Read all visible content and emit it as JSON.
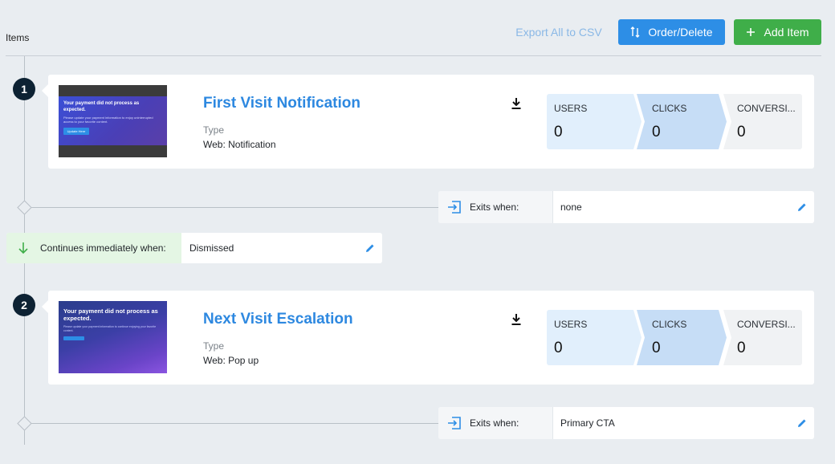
{
  "header": {
    "title": "Items",
    "export_label": "Export All to CSV",
    "order_label": "Order/Delete",
    "add_label": "Add Item"
  },
  "colors": {
    "accent_blue": "#2d8ee6",
    "add_green": "#3fae49",
    "title_blue": "#2d88e0",
    "step_badge": "#0d2233"
  },
  "items": [
    {
      "step": "1",
      "name": "First Visit Notification",
      "type_label": "Type",
      "type_value": "Web: Notification",
      "thumbnail": {
        "headline": "Your payment did not process as expected.",
        "body": "Please update your payment information to enjoy uninterrupted access to your favorite content.",
        "button": "Update Here"
      },
      "stats": [
        {
          "label": "USERS",
          "value": "0"
        },
        {
          "label": "CLICKS",
          "value": "0"
        },
        {
          "label": "CONVERSI...",
          "value": "0"
        }
      ],
      "exit": {
        "label": "Exits when:",
        "value": "none"
      }
    },
    {
      "step": "2",
      "name": "Next Visit Escalation",
      "type_label": "Type",
      "type_value": "Web: Pop up",
      "thumbnail": {
        "headline": "Your payment did not process as expected.",
        "body": "Please update your payment information to continue enjoying your favorite content."
      },
      "stats": [
        {
          "label": "USERS",
          "value": "0"
        },
        {
          "label": "CLICKS",
          "value": "0"
        },
        {
          "label": "CONVERSI...",
          "value": "0"
        }
      ],
      "exit": {
        "label": "Exits when:",
        "value": "Primary CTA"
      }
    }
  ],
  "continue": {
    "label": "Continues immediately when:",
    "value": "Dismissed"
  },
  "icons": {
    "order": "sort-arrows-icon",
    "add": "plus-icon",
    "download": "download-icon",
    "exit": "exit-icon",
    "edit": "pencil-icon",
    "continue": "arrow-down-icon"
  }
}
